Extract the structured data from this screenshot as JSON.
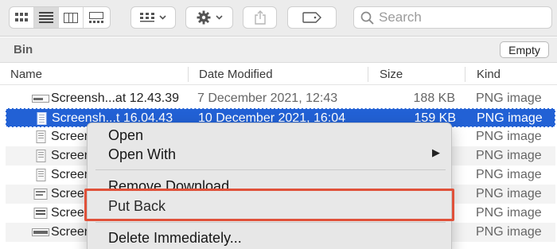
{
  "search": {
    "placeholder": "Search"
  },
  "location": {
    "title": "Bin",
    "empty_button": "Empty"
  },
  "columns": {
    "name": "Name",
    "date": "Date Modified",
    "size": "Size",
    "kind": "Kind"
  },
  "rows": [
    {
      "name": "Screensh...at 12.43.39",
      "date": "7 December 2021, 12:43",
      "size": "188 KB",
      "kind": "PNG image"
    },
    {
      "name": "Screensh...t 16.04.43",
      "date": "10 December 2021, 16:04",
      "size": "159 KB",
      "kind": "PNG image"
    },
    {
      "name": "Screen",
      "kind": "PNG image"
    },
    {
      "name": "Screen",
      "kind": "PNG image"
    },
    {
      "name": "Screen",
      "kind": "PNG image"
    },
    {
      "name": "Screen",
      "kind": "PNG image"
    },
    {
      "name": "Screen",
      "kind": "PNG image"
    },
    {
      "name": "Screen",
      "kind": "PNG image"
    }
  ],
  "menu": {
    "open": "Open",
    "open_with": "Open With",
    "remove_download": "Remove Download",
    "put_back": "Put Back",
    "delete_immediately": "Delete Immediately..."
  },
  "colors": {
    "selection": "#2261d5",
    "highlight": "#e0513a"
  }
}
